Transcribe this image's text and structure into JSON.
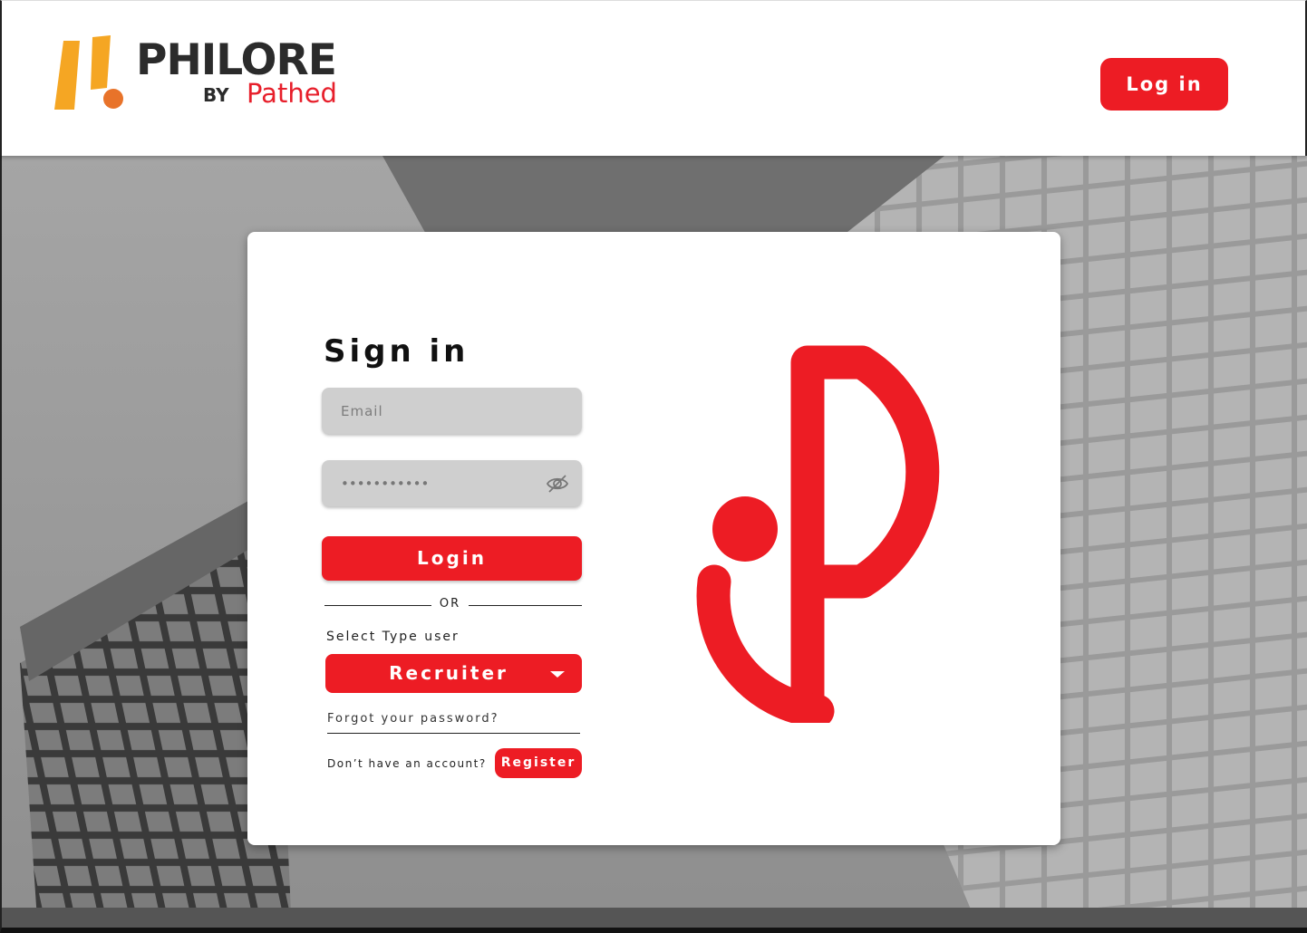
{
  "header": {
    "brand_name": "PHILORE",
    "brand_by": "BY",
    "brand_sub": "Pathed",
    "login_label": "Log in"
  },
  "signin": {
    "title": "Sign in",
    "email_placeholder": "Email",
    "password_value": "***********",
    "login_label": "Login",
    "or_label": "OR",
    "user_type_label": "Select Type user",
    "user_type_value": "Recruiter",
    "forgot_label": "Forgot your password?",
    "no_account_label": "Don’t have an account?",
    "register_label": "Register"
  },
  "colors": {
    "accent": "#ed1c24",
    "logo_orange": "#f5a623",
    "logo_dot": "#e8732a",
    "field_bg": "#cfcfcf"
  },
  "icons": {
    "password_toggle": "eye-slash-icon",
    "select_caret": "caret-down-icon"
  }
}
